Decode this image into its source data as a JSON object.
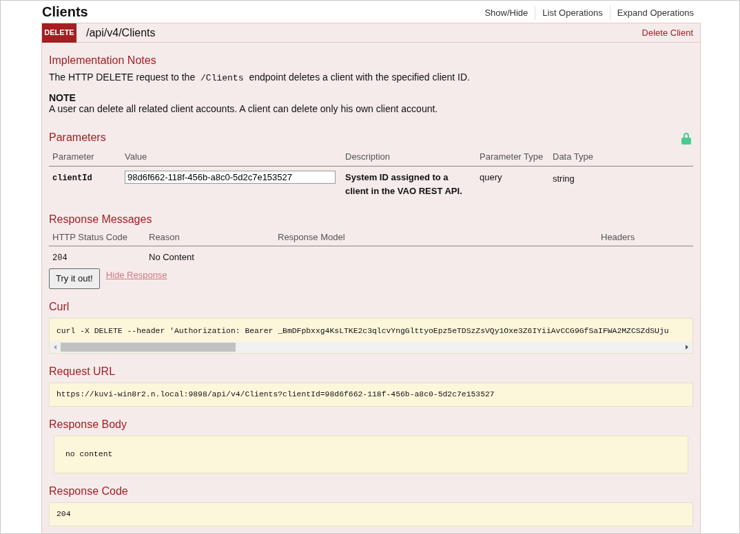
{
  "resource": {
    "title": "Clients",
    "links": [
      "Show/Hide",
      "List Operations",
      "Expand Operations"
    ]
  },
  "operation": {
    "method": "DELETE",
    "path": "/api/v4/Clients",
    "summary": "Delete Client"
  },
  "implementation_notes": {
    "heading": "Implementation Notes",
    "text_before": "The HTTP DELETE request to the",
    "code": "/Clients",
    "text_after": "endpoint deletes a client with the specified client ID.",
    "note_title": "NOTE",
    "note_text": "A user can delete all related client accounts. A client can delete only his own client account."
  },
  "parameters": {
    "heading": "Parameters",
    "columns": [
      "Parameter",
      "Value",
      "Description",
      "Parameter Type",
      "Data Type"
    ],
    "rows": [
      {
        "name": "clientId",
        "value": "98d6f662-118f-456b-a8c0-5d2c7e153527",
        "description": "System ID assigned to a client in the VAO REST API.",
        "parameter_type": "query",
        "data_type": "string"
      }
    ]
  },
  "response_messages": {
    "heading": "Response Messages",
    "columns": [
      "HTTP Status Code",
      "Reason",
      "Response Model",
      "Headers"
    ],
    "rows": [
      {
        "code": "204",
        "reason": "No Content"
      }
    ]
  },
  "buttons": {
    "try": "Try it out!",
    "hide": "Hide Response"
  },
  "curl": {
    "heading": "Curl",
    "text": "curl -X DELETE --header 'Authorization: Bearer _BmDFpbxxg4KsLTKE2c3qlcvYngGlttyoEpz5eTDSzZsVQy1Oxe3Z6IYiiAvCCG9GfSaIFWA2MZCSZdSUju"
  },
  "request_url": {
    "heading": "Request URL",
    "text": "https://kuvi-win8r2.n.local:9898/api/v4/Clients?clientId=98d6f662-118f-456b-a8c0-5d2c7e153527"
  },
  "response_body": {
    "heading": "Response Body",
    "text": "no content"
  },
  "response_code": {
    "heading": "Response Code",
    "text": "204"
  }
}
